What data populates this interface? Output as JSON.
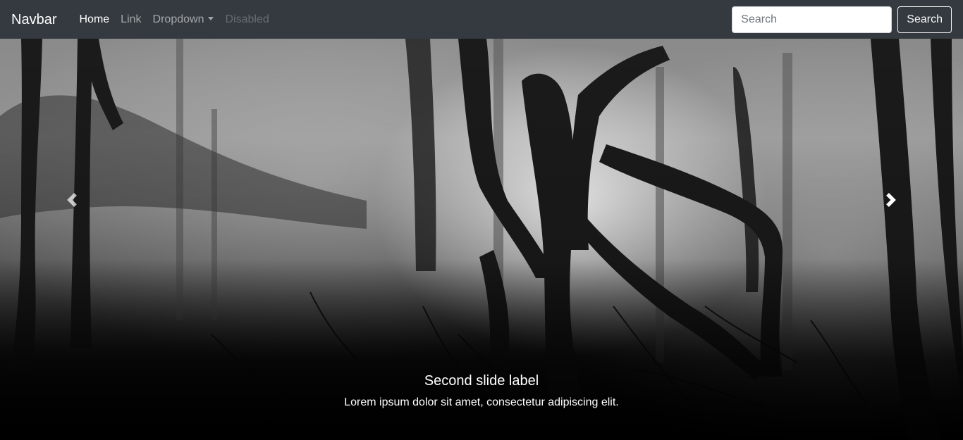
{
  "navbar": {
    "brand": "Navbar",
    "items": [
      {
        "label": "Home",
        "state": "active"
      },
      {
        "label": "Link",
        "state": "normal"
      },
      {
        "label": "Dropdown",
        "state": "dropdown"
      },
      {
        "label": "Disabled",
        "state": "disabled"
      }
    ],
    "search": {
      "placeholder": "Search",
      "value": "",
      "button_label": "Search"
    }
  },
  "carousel": {
    "caption_title": "Second slide label",
    "caption_text": "Lorem ipsum dolor sit amet, consectetur adipiscing elit.",
    "controls": {
      "prev_icon": "chevron-left-icon",
      "next_icon": "chevron-right-icon"
    }
  }
}
